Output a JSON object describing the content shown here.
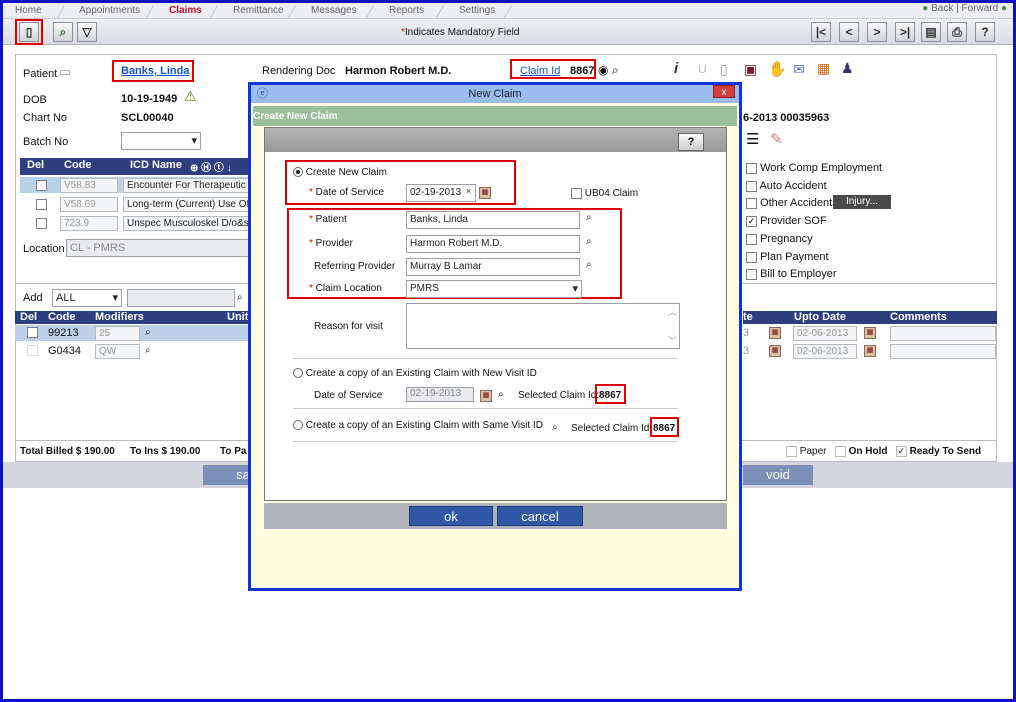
{
  "nav": {
    "tabs": [
      "Home",
      "Appointments",
      "Claims",
      "Remittance",
      "Messages",
      "Reports",
      "Settings"
    ],
    "active": "Claims",
    "back": "Back",
    "forward": "Forward"
  },
  "toolbar": {
    "mandatory": "Indicates Mandatory Field",
    "star": "*",
    "nav_buttons": [
      "|<",
      "<",
      ">",
      ">|"
    ]
  },
  "patient": {
    "label": "Patient",
    "name": "Banks, Linda",
    "dob_label": "DOB",
    "dob": "10-19-1949",
    "chart_label": "Chart No",
    "chart": "SCL00040",
    "batch_label": "Batch No"
  },
  "rendering": {
    "label": "Rendering Doc",
    "value": "Harmon Robert M.D.",
    "claim_label": "Claim Id",
    "claim_id": "8867",
    "claim_ref": "6-2013 00035963"
  },
  "icd": {
    "headers": [
      "Del",
      "Code",
      "ICD Name"
    ],
    "rows": [
      {
        "code": "V58.83",
        "name": "Encounter For Therapeutic D"
      },
      {
        "code": "V58.69",
        "name": "Long-term (Current) Use Of"
      },
      {
        "code": "723.9",
        "name": "Unspec Musculoskel D/o&s"
      }
    ],
    "location_label": "Location",
    "location_value": "CL - PMRS"
  },
  "right_options": [
    {
      "label": "Work Comp Employment",
      "checked": false
    },
    {
      "label": "Auto Accident",
      "checked": false
    },
    {
      "label": "Other Accidents",
      "checked": false
    },
    {
      "label": "Provider SOF",
      "checked": true
    },
    {
      "label": "Pregnancy",
      "checked": false
    },
    {
      "label": "Plan Payment",
      "checked": false
    },
    {
      "label": "Bill to Employer",
      "checked": false
    }
  ],
  "injury_btn": "Injury...",
  "procedures": {
    "add_label": "Add",
    "add_value": "ALL",
    "headers": [
      "Del",
      "Code",
      "Modifiers",
      "Unit"
    ],
    "right_headers": [
      "te",
      "Upto Date",
      "Comments"
    ],
    "rows": [
      {
        "code": "99213",
        "mod": "25",
        "from": "3",
        "upto": "02-06-2013"
      },
      {
        "code": "G0434",
        "mod": "QW",
        "from": "3",
        "upto": "02-06-2013"
      }
    ]
  },
  "totals": {
    "billed": "Total Billed $ 190.00",
    "ins": "To Ins $ 190.00",
    "pat": "To Pa",
    "paper": "Paper",
    "hold": "On Hold",
    "ready": "Ready To Send"
  },
  "footer": {
    "save": "sa",
    "void": "void"
  },
  "modal": {
    "title": "New Claim",
    "close": "x",
    "header": "Create New Claim",
    "help": "?",
    "create_new": "Create New Claim",
    "dos_label": "Date of Service",
    "dos_value": "02-19-2013",
    "ub04": "UB04 Claim",
    "patient_label": "Patient",
    "patient_value": "Banks, Linda",
    "provider_label": "Provider",
    "provider_value": "Harmon Robert M.D.",
    "ref_label": "Referring Provider",
    "ref_value": "Murray B Lamar",
    "loc_label": "Claim Location",
    "loc_value": "PMRS",
    "reason_label": "Reason for visit",
    "copy_new": "Create a copy of an Existing Claim with New Visit ID",
    "copy_dos_label": "Date of Service",
    "copy_dos_value": "02-19-2013",
    "sel_claim_label": "Selected Claim Id:",
    "sel_claim_value": "8867",
    "copy_same": "Create a copy of an Existing Claim with Same Visit ID",
    "sel_claim2_label": "Selected Claim Id:",
    "sel_claim2_value": "8867",
    "ok": "ok",
    "cancel": "cancel"
  }
}
